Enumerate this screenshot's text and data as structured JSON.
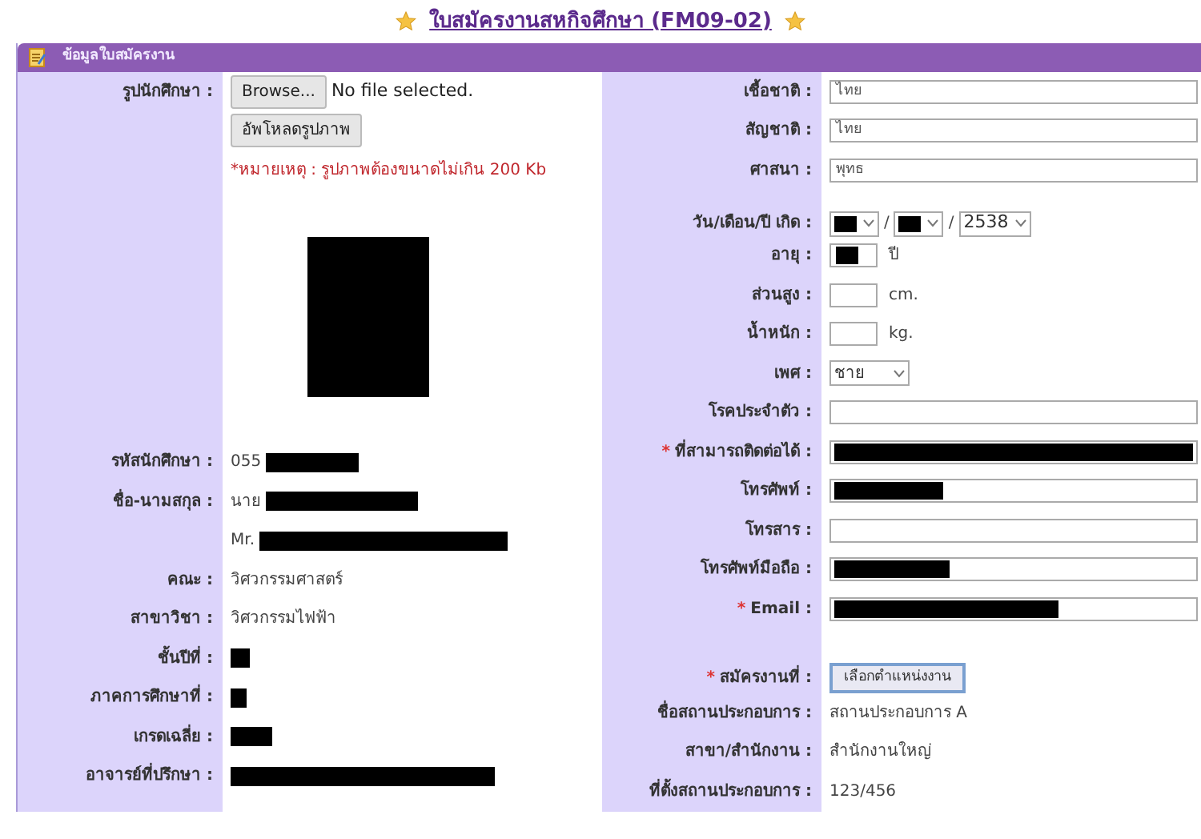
{
  "title": "ใบสมัครงานสหกิจศึกษา (FM09-02)",
  "section": {
    "title": "ข้อมูลใบสมัครงาน"
  },
  "left": [
    {
      "kind": "file",
      "label": "รูปนักศึกษา :",
      "button": "Browse...",
      "value": "No file selected."
    },
    {
      "kind": "button",
      "button": "อัพโหลดรูปภาพ"
    },
    {
      "kind": "note",
      "text": "*หมายเหตุ : รูปภาพต้องขนาดไม่เกิน 200 Kb"
    },
    {
      "kind": "photo",
      "redacted": true
    },
    {
      "kind": "text",
      "label": "รหัสนักศึกษา :",
      "value": "055",
      "redacted": true
    },
    {
      "kind": "text",
      "label": "ชื่อ-นามสกุล :",
      "value": "นาย",
      "redacted": true
    },
    {
      "kind": "text",
      "value": "Mr.",
      "redacted": true
    },
    {
      "kind": "text",
      "label": "คณะ :",
      "value": "วิศวกรรมศาสตร์"
    },
    {
      "kind": "text",
      "label": "สาขาวิชา :",
      "value": "วิศวกรรมไฟฟ้า"
    },
    {
      "kind": "text",
      "label": "ชั้นปีที่ :",
      "redacted": true
    },
    {
      "kind": "text",
      "label": "ภาคการศึกษาที่ :",
      "redacted": true
    },
    {
      "kind": "text",
      "label": "เกรดเฉลี่ย :",
      "redacted": true
    },
    {
      "kind": "text",
      "label": "อาจารย์ที่ปรึกษา :",
      "redacted": true
    }
  ],
  "right": [
    {
      "kind": "input",
      "label": "เชื้อชาติ :",
      "value": "ไทย"
    },
    {
      "kind": "input",
      "label": "สัญชาติ :",
      "value": "ไทย"
    },
    {
      "kind": "input",
      "label": "ศาสนา :",
      "value": "พุทธ"
    },
    {
      "kind": "date",
      "label": "วัน/เดือน/ปี เกิด :",
      "separator": "/",
      "year": "2538"
    },
    {
      "kind": "short",
      "label": "อายุ :",
      "redacted": true,
      "unit": "ปี"
    },
    {
      "kind": "short",
      "label": "ส่วนสูง :",
      "unit": "cm."
    },
    {
      "kind": "short",
      "label": "น้ำหนัก :",
      "unit": "kg."
    },
    {
      "kind": "select",
      "label": "เพศ :",
      "value": "ชาย"
    },
    {
      "kind": "input",
      "label": "โรคประจำตัว :"
    },
    {
      "kind": "input",
      "label": "ที่สามารถติดต่อได้ :",
      "required": "*",
      "redacted": true
    },
    {
      "kind": "input",
      "label": "โทรศัพท์ :",
      "redacted": true
    },
    {
      "kind": "input",
      "label": "โทรสาร :"
    },
    {
      "kind": "input",
      "label": "โทรศัพท์มือถือ :",
      "redacted": true
    },
    {
      "kind": "input",
      "label": "Email :",
      "required": "*",
      "redacted": true
    },
    {
      "kind": "button",
      "label": "สมัครงานที่ :",
      "required": "*",
      "button": "เลือกตำแหน่งงาน"
    },
    {
      "kind": "text",
      "label": "ชื่อสถานประกอบการ :",
      "value": "สถานประกอบการ A"
    },
    {
      "kind": "text",
      "label": "สาขา/สำนักงาน :",
      "value": "สำนักงานใหญ่"
    },
    {
      "kind": "text",
      "label": "ที่ตั้งสถานประกอบการ :",
      "value": "123/456"
    }
  ]
}
